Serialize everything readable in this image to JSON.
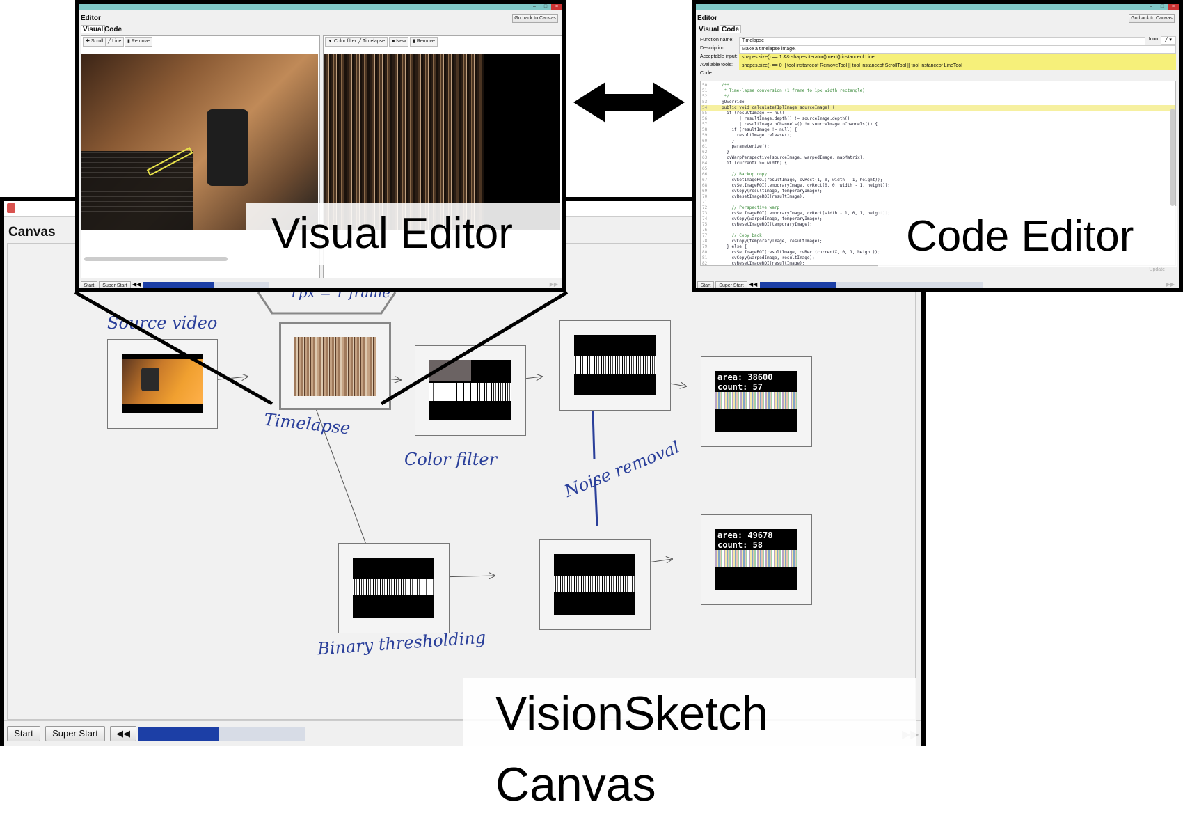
{
  "canvas": {
    "title": "Canvas",
    "caption": "VisionSketch Canvas",
    "footer": {
      "start": "Start",
      "super_start": "Super Start",
      "progress": 0.48
    },
    "nodes": {
      "n4": {
        "area": "area: 38600",
        "count": "count: 57"
      },
      "n7": {
        "area": "area: 49678",
        "count": "count: 58"
      }
    },
    "annotations": {
      "source": "Source video",
      "frame": "1px = 1 frame",
      "timelapse": "Timelapse",
      "color_filter": "Color filter",
      "noise_removal": "Noise removal",
      "binary": "Binary thresholding"
    }
  },
  "visual_editor": {
    "window_title": "Editor",
    "back_button": "Go back to Canvas",
    "tabs": [
      "Visual",
      "Code"
    ],
    "left_tools": [
      "Scroll",
      "Line",
      "Remove"
    ],
    "right_tools": [
      "Color filter",
      "Timelapse",
      "New",
      "Remove"
    ],
    "footer": {
      "start": "Start",
      "super_start": "Super Start",
      "progress": 0.56
    },
    "caption": "Visual Editor"
  },
  "code_editor": {
    "window_title": "Editor",
    "back_button": "Go back to Canvas",
    "tabs": [
      "Visual",
      "Code"
    ],
    "fields": {
      "function_name_label": "Function name:",
      "function_name": "Timelapse",
      "icon_label": "Icon:",
      "description_label": "Description:",
      "description": "Make a timelapse image.",
      "acceptable_label": "Acceptable input:",
      "acceptable": "shapes.size() == 1 && shapes.iterator().next() instanceof Line",
      "tools_label": "Available tools:",
      "tools": "shapes.size() == 0 || tool instanceof RemoveTool || tool instanceof ScrollTool || tool instanceof LineTool",
      "code_label": "Code:"
    },
    "code_lines": [
      {
        "n": "50",
        "t": "/**"
      },
      {
        "n": "51",
        "t": " * Time-lapse conversion (1 frame to 1px width rectangle)"
      },
      {
        "n": "52",
        "t": " */"
      },
      {
        "n": "53",
        "t": "@Override"
      },
      {
        "n": "54",
        "t": "public void calculate(IplImage sourceImage) {"
      },
      {
        "n": "55",
        "t": "  if (resultImage == null"
      },
      {
        "n": "56",
        "t": "      || resultImage.depth() != sourceImage.depth()"
      },
      {
        "n": "57",
        "t": "      || resultImage.nChannels() != sourceImage.nChannels()) {"
      },
      {
        "n": "58",
        "t": "    if (resultImage != null) {"
      },
      {
        "n": "59",
        "t": "      resultImage.release();"
      },
      {
        "n": "60",
        "t": "    }"
      },
      {
        "n": "61",
        "t": "    parameterize();"
      },
      {
        "n": "62",
        "t": "  }"
      },
      {
        "n": "63",
        "t": "  cvWarpPerspective(sourceImage, warpedImage, mapMatrix);"
      },
      {
        "n": "64",
        "t": "  if (currentX >= width) {"
      },
      {
        "n": "65",
        "t": ""
      },
      {
        "n": "66",
        "t": "    // Backup copy"
      },
      {
        "n": "67",
        "t": "    cvSetImageROI(resultImage, cvRect(1, 0, width - 1, height));"
      },
      {
        "n": "68",
        "t": "    cvSetImageROI(temporaryImage, cvRect(0, 0, width - 1, height));"
      },
      {
        "n": "69",
        "t": "    cvCopy(resultImage, temporaryImage);"
      },
      {
        "n": "70",
        "t": "    cvResetImageROI(resultImage);"
      },
      {
        "n": "71",
        "t": ""
      },
      {
        "n": "72",
        "t": "    // Perspective warp"
      },
      {
        "n": "73",
        "t": "    cvSetImageROI(temporaryImage, cvRect(width - 1, 0, 1, height));"
      },
      {
        "n": "74",
        "t": "    cvCopy(warpedImage, temporaryImage);"
      },
      {
        "n": "75",
        "t": "    cvResetImageROI(temporaryImage);"
      },
      {
        "n": "76",
        "t": ""
      },
      {
        "n": "77",
        "t": "    // Copy back"
      },
      {
        "n": "78",
        "t": "    cvCopy(temporaryImage, resultImage);"
      },
      {
        "n": "79",
        "t": "  } else {"
      },
      {
        "n": "80",
        "t": "    cvSetImageROI(resultImage, cvRect(currentX, 0, 1, height));"
      },
      {
        "n": "81",
        "t": "    cvCopy(warpedImage, resultImage);"
      },
      {
        "n": "82",
        "t": "    cvResetImageROI(resultImage);"
      },
      {
        "n": "83",
        "t": "    currentX ++;"
      }
    ],
    "footer": {
      "start": "Start",
      "super_start": "Super Start",
      "progress": 0.34
    },
    "update_label": "Update",
    "caption": "Code Editor"
  },
  "colors": {
    "accent": "#1c3fa6",
    "titlebar": "#7fc7c6",
    "annotation_ink": "#2a3f9a",
    "highlight": "#f6f07a"
  }
}
